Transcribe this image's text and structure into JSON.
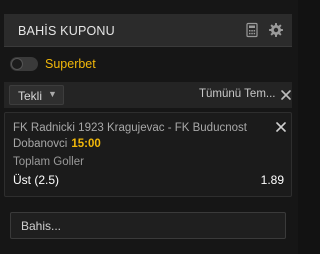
{
  "header": {
    "title": "BAHİS KUPONU",
    "icons": [
      "calculator-icon",
      "gear-icon"
    ]
  },
  "superbet": {
    "label": "Superbet",
    "enabled": false
  },
  "tabbar": {
    "mode_selected": "Tekli",
    "clear_all_label": "Tümünü Tem..."
  },
  "bet": {
    "match": "FK Radnicki 1923 Kragujevac - FK Buducnost Dobanovci",
    "time": "15:00",
    "market": "Toplam Goller",
    "selection": "Üst (2.5)",
    "odds": "1.89"
  },
  "stake": {
    "placeholder": "Bahis..."
  },
  "colors": {
    "accent": "#f2b80a",
    "background": "#161616",
    "header": "#2b2b2b"
  }
}
